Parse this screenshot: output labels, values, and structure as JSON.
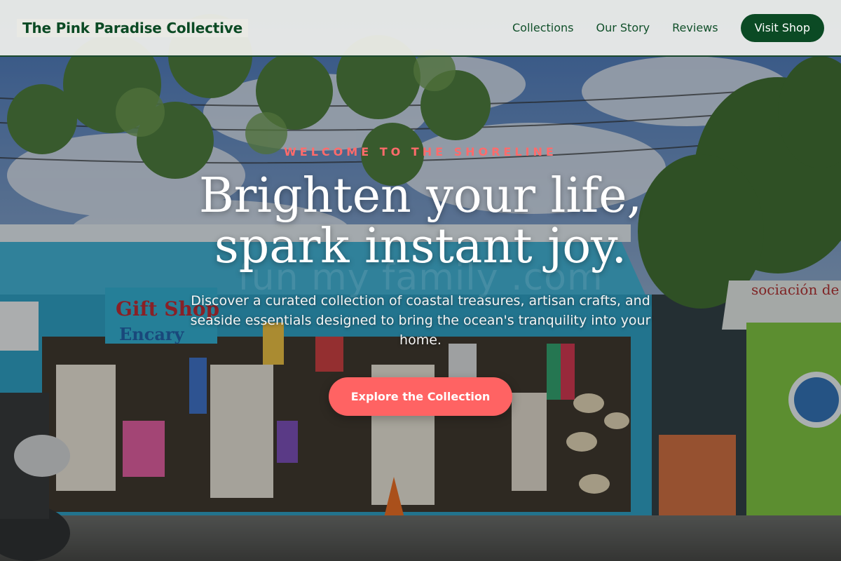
{
  "header": {
    "brand": "The Pink Paradise Collective",
    "nav": [
      {
        "label": "Collections"
      },
      {
        "label": "Our Story"
      },
      {
        "label": "Reviews"
      }
    ],
    "cta_label": "Visit Shop"
  },
  "hero": {
    "eyebrow": "WELCOME TO THE SHORELINE",
    "headline_line1": "Brighten your life,",
    "headline_line2": "spark instant joy.",
    "subtext": "Discover a curated collection of coastal treasures, artisan crafts, and seaside essentials designed to bring the ocean's tranquility into your home.",
    "cta_label": "Explore the Collection",
    "background_image": "tropical gift shop storefront"
  },
  "colors": {
    "brand_green": "#0b4a24",
    "accent_coral": "#ff6363",
    "eyebrow_coral": "#ff6b6b",
    "header_bg": "#f0f0ec"
  },
  "icons": {}
}
